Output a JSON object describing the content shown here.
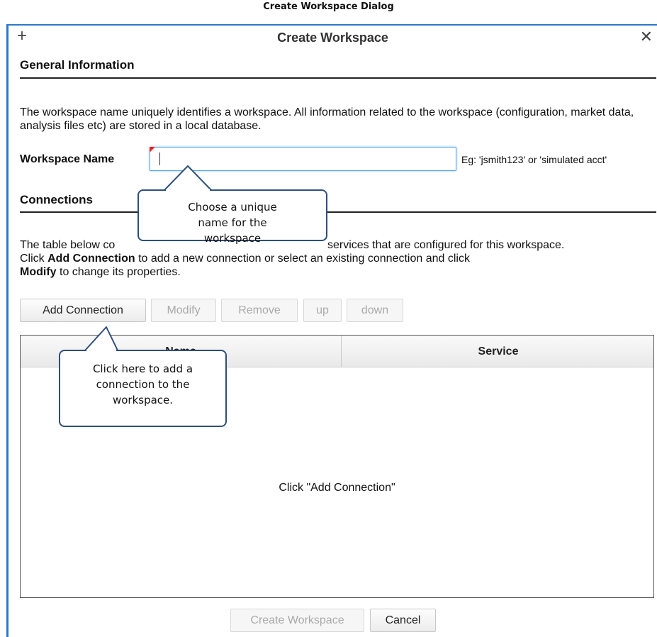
{
  "caption": "Create Workspace Dialog",
  "dialog": {
    "title": "Create Workspace",
    "add_icon": "plus-icon",
    "close_icon": "close-icon"
  },
  "general": {
    "title": "General Information",
    "description": "The workspace name uniquely identifies a workspace. All information related to the workspace (configuration, market data, analysis files etc) are stored in a local database.",
    "workspace_name_label": "Workspace Name",
    "workspace_name_value": "",
    "workspace_name_hint": "Eg: 'jsmith123' or 'simulated acct'"
  },
  "connections": {
    "title": "Connections",
    "desc_part1": "The table below co",
    "desc_part2": " services that are configured for this workspace.",
    "desc_line2_a": "Click ",
    "desc_add_bold": "Add Connection",
    "desc_line2_b": " to add a new connection or select an existing connection and click",
    "desc_modify_bold": "Modify",
    "desc_line3_b": " to change its properties.",
    "buttons": {
      "add": "Add Connection",
      "modify": "Modify",
      "remove": "Remove",
      "up": "up",
      "down": "down"
    },
    "table": {
      "columns": [
        "Name",
        "Service"
      ],
      "empty_message": "Click \"Add Connection\""
    }
  },
  "footer": {
    "create": "Create Workspace",
    "cancel": "Cancel"
  },
  "callouts": {
    "name_tip": "Choose a unique name for the workspace",
    "add_tip": "Click here to add a connection to the workspace."
  }
}
